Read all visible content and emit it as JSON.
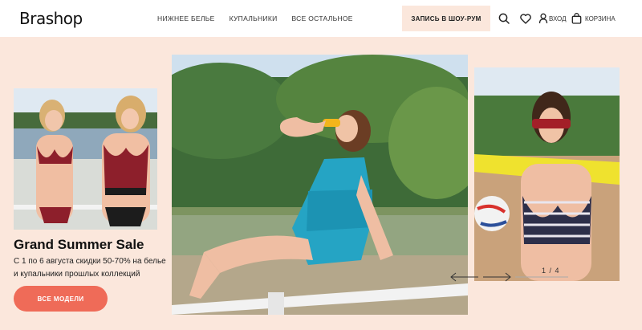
{
  "header": {
    "logo": "Brashop",
    "nav": [
      "НИЖНЕЕ БЕЛЬЕ",
      "КУПАЛЬНИКИ",
      "ВСЕ ОСТАЛЬНОЕ"
    ],
    "cta_label": "ЗАПИСЬ В ШОУ-РУМ",
    "login_label": "ВХОД",
    "cart_label": "КОРЗИНА",
    "icons": [
      "search-icon",
      "heart-icon",
      "user-icon",
      "cart-icon"
    ]
  },
  "promo": {
    "title": "Grand Summer Sale",
    "text": "С 1 по 6 августа скидки 50-70% на белье и купальники прошлых коллекций",
    "button_label": "ВСЕ МОДЕЛИ"
  },
  "slider": {
    "pager": "1 / 4"
  },
  "colors": {
    "background": "#fbe7dc",
    "accent": "#ef6b58",
    "header": "#ffffff"
  }
}
